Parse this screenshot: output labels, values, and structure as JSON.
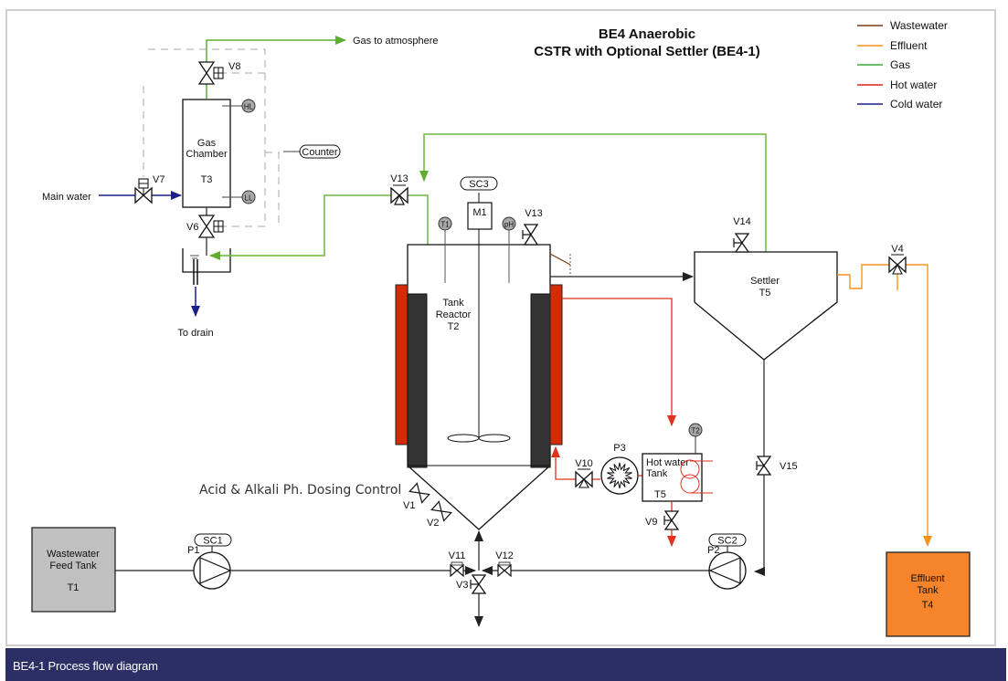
{
  "title": {
    "line1": "BE4 Anaerobic",
    "line2": "CSTR with Optional Settler (BE4-1)"
  },
  "legend": [
    {
      "label": "Wastewater",
      "color": "#7a3b12"
    },
    {
      "label": "Effluent",
      "color": "#f7941d"
    },
    {
      "label": "Gas",
      "color": "#3aa53a"
    },
    {
      "label": "Hot water",
      "color": "#e0201b"
    },
    {
      "label": "Cold water",
      "color": "#1b1f8a"
    }
  ],
  "colors": {
    "gas_line": "#6ab83f",
    "hot_water_line": "#e0301e",
    "cold_water_line": "#1b1f8a",
    "effluent_line": "#f7941d",
    "heater_jacket": "#d42a06",
    "insulation": "#333333",
    "feed_tank_fill": "#c0c0c0",
    "effluent_tank_fill": "#f5842a",
    "sensor_fill": "#a8a8a8",
    "caption_bar": "#2b2f66"
  },
  "labels": {
    "gas_to_atmosphere": "Gas to atmosphere",
    "main_water": "Main water",
    "to_drain": "To drain",
    "counter": "Counter",
    "dosing_control": "Acid & Alkali Ph. Dosing Control"
  },
  "equipment": {
    "gas_chamber": {
      "line1": "Gas",
      "line2": "Chamber",
      "id": "T3"
    },
    "tank_reactor": {
      "line1": "Tank",
      "line2": "Reactor",
      "id": "T2"
    },
    "settler": {
      "line1": "Settler",
      "id": "T5"
    },
    "hot_water_tank": {
      "line1": "Hot water",
      "line2": "Tank",
      "id": "T5"
    },
    "feed_tank": {
      "line1": "Wastewater",
      "line2": "Feed Tank",
      "id": "T1"
    },
    "effluent_tank": {
      "line1": "Effluent",
      "line2": "Tank",
      "id": "T4"
    },
    "motor": "M1"
  },
  "sensors": {
    "hl": "HL",
    "ll": "LL",
    "t1": "T1",
    "ph": "pH",
    "t2": "T2"
  },
  "controllers": {
    "sc1": "SC1",
    "sc2": "SC2",
    "sc3": "SC3"
  },
  "pumps": {
    "p1": "P1",
    "p2": "P2",
    "p3": "P3"
  },
  "valves": {
    "v1": "V1",
    "v2": "V2",
    "v3": "V3",
    "v4": "V4",
    "v6": "V6",
    "v7": "V7",
    "v8": "V8",
    "v9": "V9",
    "v10": "V10",
    "v11": "V11",
    "v12": "V12",
    "v13a": "V13",
    "v13b": "V13",
    "v14": "V14",
    "v15": "V15"
  },
  "caption": "BE4-1 Process flow diagram"
}
